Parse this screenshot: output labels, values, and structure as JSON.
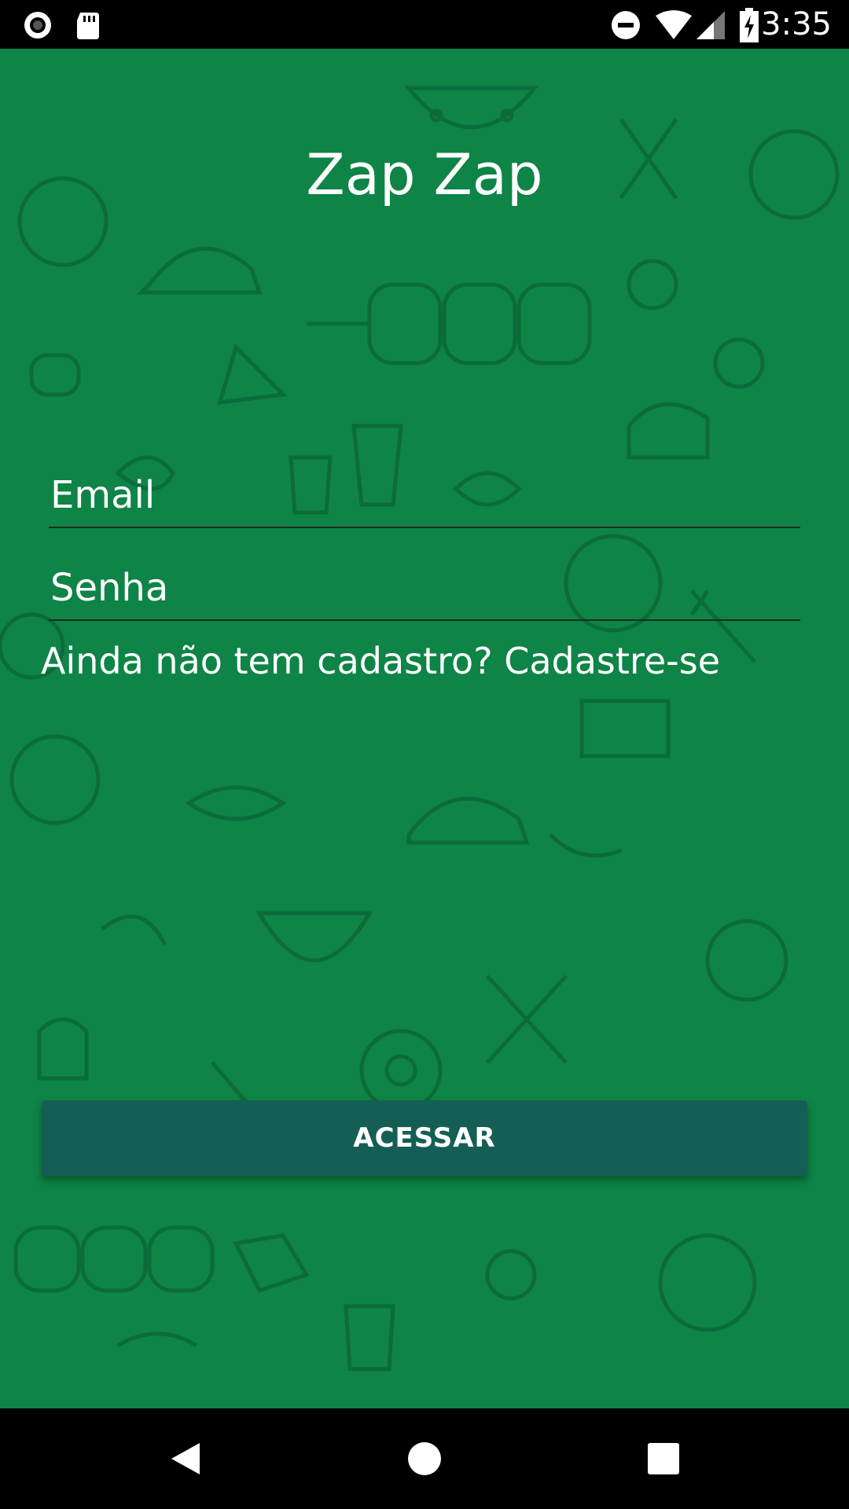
{
  "status_bar": {
    "time": "3:35",
    "icons": [
      "record-icon",
      "sd-card-icon",
      "do-not-disturb-icon",
      "wifi-icon",
      "signal-icon",
      "battery-charging-icon"
    ]
  },
  "app": {
    "title": "Zap Zap",
    "email_placeholder": "Email",
    "password_placeholder": "Senha",
    "signup_prompt": "Ainda não tem cadastro? Cadastre-se",
    "login_button": "ACESSAR"
  },
  "nav_bar": {
    "icons": [
      "back-icon",
      "home-icon",
      "recents-icon"
    ]
  },
  "colors": {
    "background": "#0e8446",
    "button": "#155e55",
    "text": "#ffffff"
  }
}
